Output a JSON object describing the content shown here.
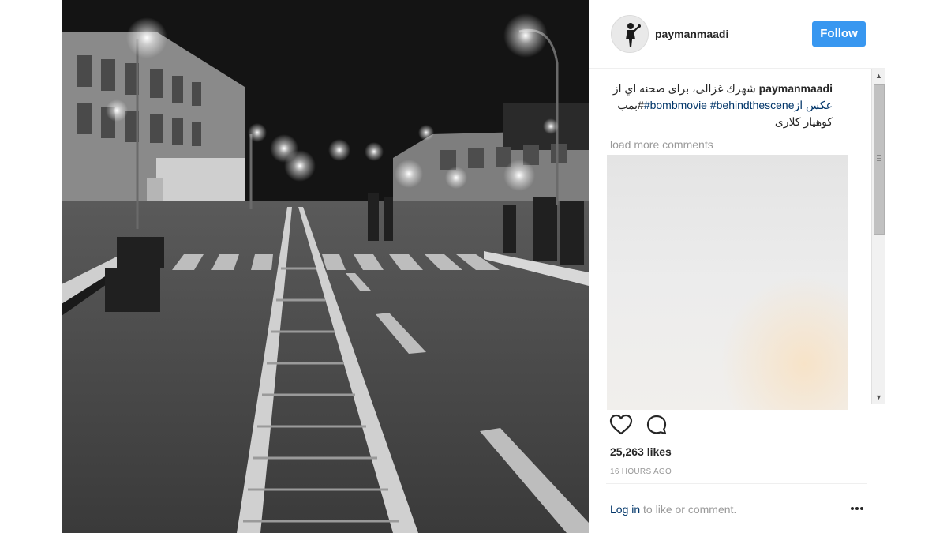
{
  "post": {
    "username": "paymanmaadi",
    "follow_label": "Follow",
    "caption_user": "paymanmaadi",
    "caption_line1": "شهرك غزالى، براى صحنه اي از",
    "caption_line2_link": "عكس از",
    "caption_line2_tags": "#bombmovie #behindthescene",
    "caption_line2_end": "#بمب",
    "caption_line3": "كوهيار كلارى",
    "load_more": "load more comments",
    "likes": "25,263 likes",
    "time": "16 HOURS AGO",
    "login_link": "Log in",
    "login_rest": " to like or comment."
  },
  "colors": {
    "accent": "#3897f0",
    "link": "#003569",
    "muted": "#999999"
  },
  "icons": {
    "like": "heart-icon",
    "comment": "comment-bubble-icon",
    "more": "ellipsis-icon"
  }
}
